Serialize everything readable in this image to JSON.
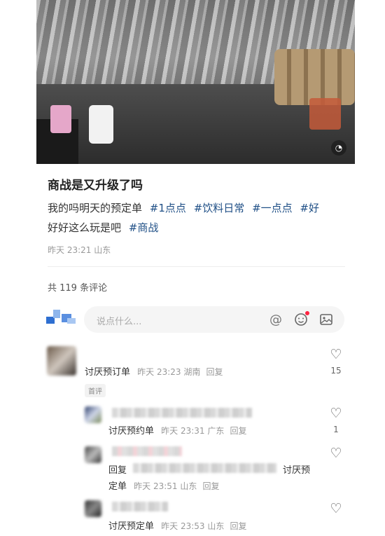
{
  "post": {
    "title": "商战是又升级了吗",
    "body_text": "我的吗明天的预定单",
    "tags": [
      "#1点点",
      "#饮料日常",
      "#一点点",
      "#好",
      "好好这么玩是吧",
      "#商战"
    ],
    "meta": "昨天 23:21 山东"
  },
  "comments_section": {
    "count_text": "共 119 条评论",
    "input_placeholder": "说点什么...",
    "icons": [
      "at-icon",
      "emoji-icon",
      "image-icon"
    ]
  },
  "comments": [
    {
      "name": "讨厌预订单",
      "time": "昨天 23:23 湖南",
      "reply_label": "回复",
      "likes": "15",
      "badge": "首评"
    },
    {
      "name": "讨厌预约单",
      "time": "昨天 23:31 广东",
      "reply_label": "回复",
      "likes": "1"
    },
    {
      "prefix": "回复",
      "mention": "讨厌预",
      "name": "定单",
      "time": "昨天 23:51 山东",
      "reply_label": "回复"
    },
    {
      "name": "讨厌预定单",
      "time": "昨天 23:53 山东",
      "reply_label": "回复"
    }
  ],
  "colors": {
    "tag": "#1f4f86",
    "notify_dot": "#ff2442"
  }
}
